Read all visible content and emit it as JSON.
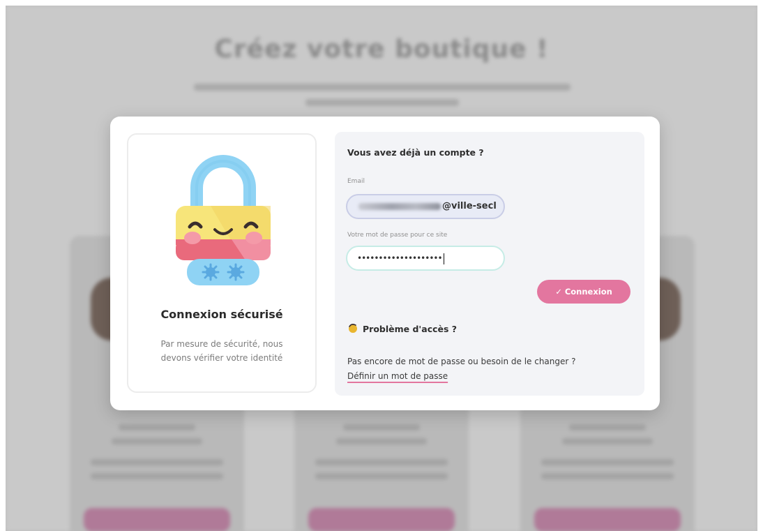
{
  "background": {
    "title": "Créez votre boutique !"
  },
  "login_panel": {
    "heading": "Vous avez déjà un compte ?",
    "email_label": "Email",
    "email_value": "@ville-secl",
    "password_label": "Votre mot de passe pour ce site",
    "password_value": "••••••••••••••••••••",
    "connect_button": "✓ Connexion",
    "problem_heading": "Problème d'accès ?",
    "help_text": "Pas encore de mot de passe ou besoin de le changer ?",
    "define_link": "Définir un mot de passe"
  },
  "security_card": {
    "title": "Connexion sécurisé",
    "description": "Par mesure de sécurité, nous devons vérifier votre identité"
  },
  "colors": {
    "accent_pink": "#e3769f",
    "lock_shackle": "#8fd3f4",
    "lock_body": "#f7e57a",
    "lock_bottom": "#e96a7c"
  },
  "icons": [
    "lock-illustration-icon",
    "checkmark-icon",
    "hand-wave-icon"
  ]
}
